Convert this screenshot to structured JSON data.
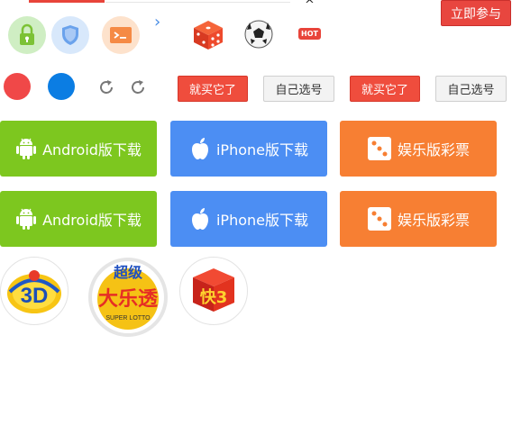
{
  "header": {
    "caret_glyph": "^",
    "join_button": "立即参与",
    "hot_badge": "HOT",
    "chevron_glyph": "›"
  },
  "icons": {
    "lock": "lock-icon",
    "shield": "shield-icon",
    "terminal": "terminal-icon",
    "dice": "dice-icon",
    "football": "football-icon",
    "refresh": "refresh-icon"
  },
  "actions": {
    "buy_it": "就买它了",
    "pick_own": "自己选号"
  },
  "downloads": [
    {
      "android": "Android版下载",
      "iphone": "iPhone版下载",
      "fun": "娱乐版彩票"
    },
    {
      "android": "Android版下载",
      "iphone": "iPhone版下载",
      "fun": "娱乐版彩票"
    }
  ],
  "lottery_logos": {
    "d3": {
      "text": "3D"
    },
    "superlotto": {
      "top": "超级",
      "main": "大乐透",
      "sub": "SUPER LOTTO"
    },
    "k3": {
      "text": "快3"
    }
  },
  "colors": {
    "accent_red": "#e8443a",
    "android_green": "#7dc71f",
    "iphone_blue": "#4c8ef3",
    "fun_orange": "#f77f33",
    "dot_red": "#f04848",
    "dot_blue": "#0b7de3"
  }
}
